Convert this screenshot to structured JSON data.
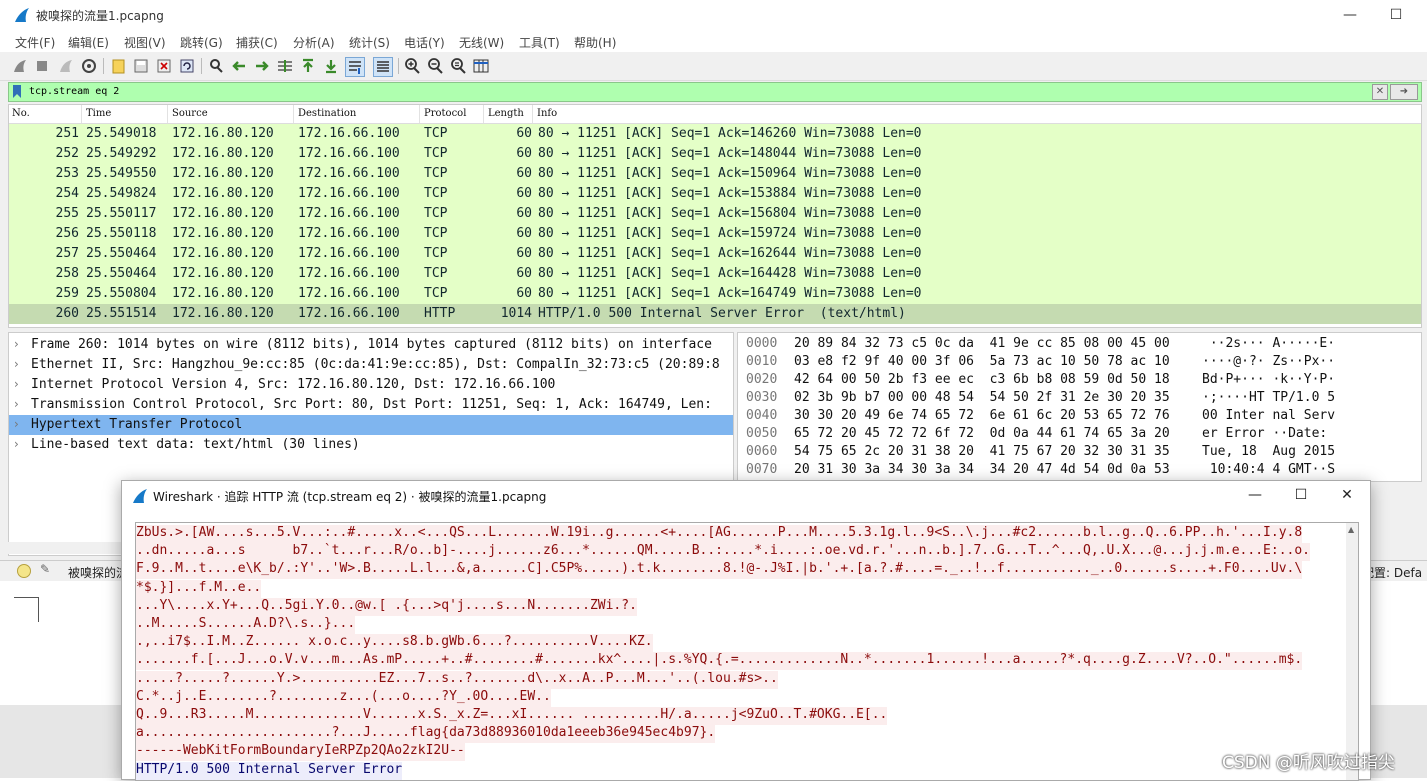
{
  "window": {
    "title": "被嗅探的流量1.pcapng"
  },
  "menu": [
    "文件(F)",
    "编辑(E)",
    "视图(V)",
    "跳转(G)",
    "捕获(C)",
    "分析(A)",
    "统计(S)",
    "电话(Y)",
    "无线(W)",
    "工具(T)",
    "帮助(H)"
  ],
  "filter": {
    "value": "tcp.stream eq 2"
  },
  "columns": [
    "No.",
    "Time",
    "Source",
    "Destination",
    "Protocol",
    "Length",
    "Info"
  ],
  "packets": [
    {
      "no": "251",
      "time": "25.549018",
      "src": "172.16.80.120",
      "dst": "172.16.66.100",
      "proto": "TCP",
      "len": "60",
      "info": "80 → 11251 [ACK] Seq=1 Ack=146260 Win=73088 Len=0"
    },
    {
      "no": "252",
      "time": "25.549292",
      "src": "172.16.80.120",
      "dst": "172.16.66.100",
      "proto": "TCP",
      "len": "60",
      "info": "80 → 11251 [ACK] Seq=1 Ack=148044 Win=73088 Len=0"
    },
    {
      "no": "253",
      "time": "25.549550",
      "src": "172.16.80.120",
      "dst": "172.16.66.100",
      "proto": "TCP",
      "len": "60",
      "info": "80 → 11251 [ACK] Seq=1 Ack=150964 Win=73088 Len=0"
    },
    {
      "no": "254",
      "time": "25.549824",
      "src": "172.16.80.120",
      "dst": "172.16.66.100",
      "proto": "TCP",
      "len": "60",
      "info": "80 → 11251 [ACK] Seq=1 Ack=153884 Win=73088 Len=0"
    },
    {
      "no": "255",
      "time": "25.550117",
      "src": "172.16.80.120",
      "dst": "172.16.66.100",
      "proto": "TCP",
      "len": "60",
      "info": "80 → 11251 [ACK] Seq=1 Ack=156804 Win=73088 Len=0"
    },
    {
      "no": "256",
      "time": "25.550118",
      "src": "172.16.80.120",
      "dst": "172.16.66.100",
      "proto": "TCP",
      "len": "60",
      "info": "80 → 11251 [ACK] Seq=1 Ack=159724 Win=73088 Len=0"
    },
    {
      "no": "257",
      "time": "25.550464",
      "src": "172.16.80.120",
      "dst": "172.16.66.100",
      "proto": "TCP",
      "len": "60",
      "info": "80 → 11251 [ACK] Seq=1 Ack=162644 Win=73088 Len=0"
    },
    {
      "no": "258",
      "time": "25.550464",
      "src": "172.16.80.120",
      "dst": "172.16.66.100",
      "proto": "TCP",
      "len": "60",
      "info": "80 → 11251 [ACK] Seq=1 Ack=164428 Win=73088 Len=0"
    },
    {
      "no": "259",
      "time": "25.550804",
      "src": "172.16.80.120",
      "dst": "172.16.66.100",
      "proto": "TCP",
      "len": "60",
      "info": "80 → 11251 [ACK] Seq=1 Ack=164749 Win=73088 Len=0"
    },
    {
      "no": "260",
      "time": "25.551514",
      "src": "172.16.80.120",
      "dst": "172.16.66.100",
      "proto": "HTTP",
      "len": "1014",
      "info": "HTTP/1.0 500 Internal Server Error  (text/html)"
    }
  ],
  "details": [
    "Frame 260: 1014 bytes on wire (8112 bits), 1014 bytes captured (8112 bits) on interface",
    "Ethernet II, Src: Hangzhou_9e:cc:85 (0c:da:41:9e:cc:85), Dst: CompalIn_32:73:c5 (20:89:8",
    "Internet Protocol Version 4, Src: 172.16.80.120, Dst: 172.16.66.100",
    "Transmission Control Protocol, Src Port: 80, Dst Port: 11251, Seq: 1, Ack: 164749, Len:",
    "Hypertext Transfer Protocol",
    "Line-based text data: text/html (30 lines)"
  ],
  "hex": [
    {
      "off": "0000",
      "hex": "20 89 84 32 73 c5 0c da  41 9e cc 85 08 00 45 00",
      "ascii": " ··2s··· A·····E·"
    },
    {
      "off": "0010",
      "hex": "03 e8 f2 9f 40 00 3f 06  5a 73 ac 10 50 78 ac 10",
      "ascii": "····@·?· Zs··Px··"
    },
    {
      "off": "0020",
      "hex": "42 64 00 50 2b f3 ee ec  c3 6b b8 08 59 0d 50 18",
      "ascii": "Bd·P+··· ·k··Y·P·"
    },
    {
      "off": "0030",
      "hex": "02 3b 9b b7 00 00 48 54  54 50 2f 31 2e 30 20 35",
      "ascii": "·;····HT TP/1.0 5"
    },
    {
      "off": "0040",
      "hex": "30 30 20 49 6e 74 65 72  6e 61 6c 20 53 65 72 76",
      "ascii": "00 Inter nal Serv"
    },
    {
      "off": "0050",
      "hex": "65 72 20 45 72 72 6f 72  0d 0a 44 61 74 65 3a 20",
      "ascii": "er Error ··Date: "
    },
    {
      "off": "0060",
      "hex": "54 75 65 2c 20 31 38 20  41 75 67 20 32 30 31 35",
      "ascii": "Tue, 18  Aug 2015"
    },
    {
      "off": "0070",
      "hex": "20 31 30 3a 34 30 3a 34  34 20 47 4d 54 0d 0a 53",
      "ascii": " 10:40:4 4 GMT··S"
    }
  ],
  "status": {
    "file": "被嗅探的流",
    "profile": "配置: Defa"
  },
  "dialog": {
    "title": "Wireshark · 追踪 HTTP 流 (tcp.stream eq 2) · 被嗅探的流量1.pcapng"
  },
  "stream_lines": [
    {
      "side": "client",
      "text": "ZbUs.>.[AW....s...5.V...:..#.....x..<...QS...L.......W.19i..g......<+....[AG......P...M....5.3.1g.l..9<S..\\.j...#c2......b.l..g..Q..6.PP..h.'...I.y.8"
    },
    {
      "side": "client",
      "text": "..dn.....a...s      b7..`t...r...R/o..b]-....j......z6...*......QM.....B..:....*.i....:.oe.vd.r.'...n..b.].7..G...T..^...Q,.U.X...@...j.j.m.e...E:..o."
    },
    {
      "side": "client",
      "text": "F.9..M..t....e\\K_b/.:Y'..'W>.B.....L.l...&,a......C].C5P%.....).t.k........8.!@-.J%I.|b.'.+.[a.?.#....=._..!..f..........._..0......s....+.F0....Uv.\\"
    },
    {
      "side": "client",
      "text": "*$.}]...f.M..e.."
    },
    {
      "side": "client",
      "text": "...Y\\....x.Y+...Q..5gi.Y.0..@w.[ .{...>q'j....s...N.......ZWi.?."
    },
    {
      "side": "client",
      "text": "..M.....S......A.D?\\.s..}..."
    },
    {
      "side": "client",
      "text": ".,..i7$..I.M..Z...... x.o.c..y....s8.b.gWb.6...?..........V....KZ."
    },
    {
      "side": "client",
      "text": ".......f.[...J...o.V.v...m...As.mP.....+..#........#.......kx^....|.s.%YQ.{.=.............N..*.......1......!...a.....?*.q....g.Z....V?..O.\"......m$."
    },
    {
      "side": "client",
      "text": ".....?.....?......Y.>..........EZ...7..s..?.......d\\..x..A..P...M...'..(.lou.#s>.."
    },
    {
      "side": "client",
      "text": "C.*..j..E........?........z...(...o....?Y_.0O....EW.."
    },
    {
      "side": "client",
      "text": "Q..9...R3.....M..............V......x.S._x.Z=...xI...... ..........H/.a.....j<9ZuO..T.#OKG..E[.."
    },
    {
      "side": "client",
      "text": "a........................?...J.....flag{da73d88936010da1eeeb36e945ec4b97}."
    },
    {
      "side": "client",
      "text": "------WebKitFormBoundaryIeRPZp2QAo2zkI2U--"
    },
    {
      "side": "server",
      "text": "HTTP/1.0 500 Internal Server Error"
    }
  ],
  "watermark": "CSDN @听风吹过指尖",
  "colors": {
    "tcp_row": "#e4ffc7",
    "selected_row": "#c5dbb1",
    "selected_tree": "#7fb5ef",
    "filter_ok": "#afffaf",
    "client_text": "#8b0b0b",
    "server_text": "#08086e"
  }
}
